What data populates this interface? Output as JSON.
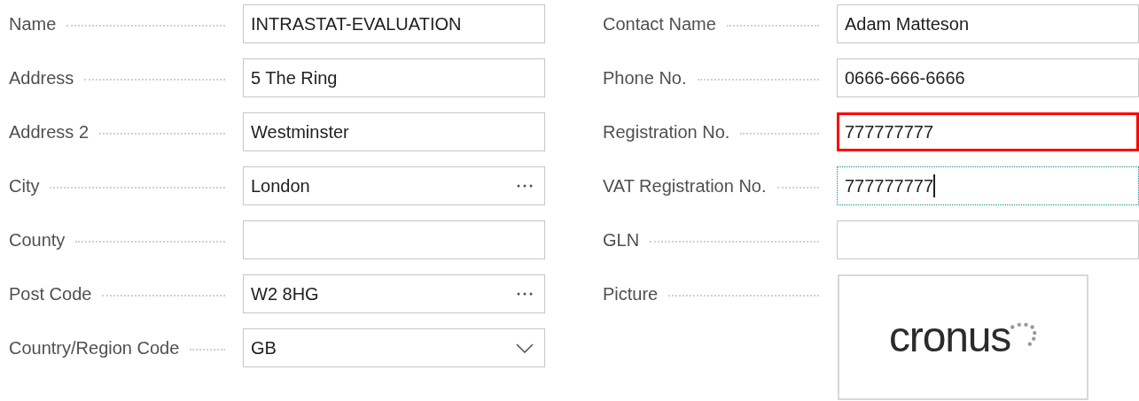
{
  "left_fields": [
    {
      "label": "Name",
      "value": "INTRASTAT-EVALUATION",
      "kind": "text",
      "error": false,
      "focused": false
    },
    {
      "label": "Address",
      "value": "5 The Ring",
      "kind": "text",
      "error": false,
      "focused": false
    },
    {
      "label": "Address 2",
      "value": "Westminster",
      "kind": "text",
      "error": false,
      "focused": false
    },
    {
      "label": "City",
      "value": "London",
      "kind": "lookup",
      "error": false,
      "focused": false
    },
    {
      "label": "County",
      "kind": "text",
      "error": false,
      "focused": false
    },
    {
      "label": "Post Code",
      "value": "W2 8HG",
      "kind": "lookup",
      "error": false,
      "focused": false
    },
    {
      "label": "Country/Region Code",
      "value": "GB",
      "kind": "dropdown",
      "error": false,
      "focused": false
    }
  ],
  "right_fields": [
    {
      "label": "Contact Name",
      "value": "Adam Matteson",
      "kind": "text",
      "error": false,
      "focused": false
    },
    {
      "label": "Phone No.",
      "value": "0666-666-6666",
      "kind": "text",
      "error": false,
      "focused": false
    },
    {
      "label": "Registration No.",
      "value": "777777777",
      "kind": "text",
      "error": true,
      "focused": false
    },
    {
      "label": "VAT Registration No.",
      "value": "777777777",
      "kind": "text",
      "error": false,
      "focused": true
    },
    {
      "label": "GLN",
      "kind": "text",
      "error": false,
      "focused": false
    }
  ],
  "picture": {
    "label": "Picture",
    "logo_text": "cronus"
  }
}
